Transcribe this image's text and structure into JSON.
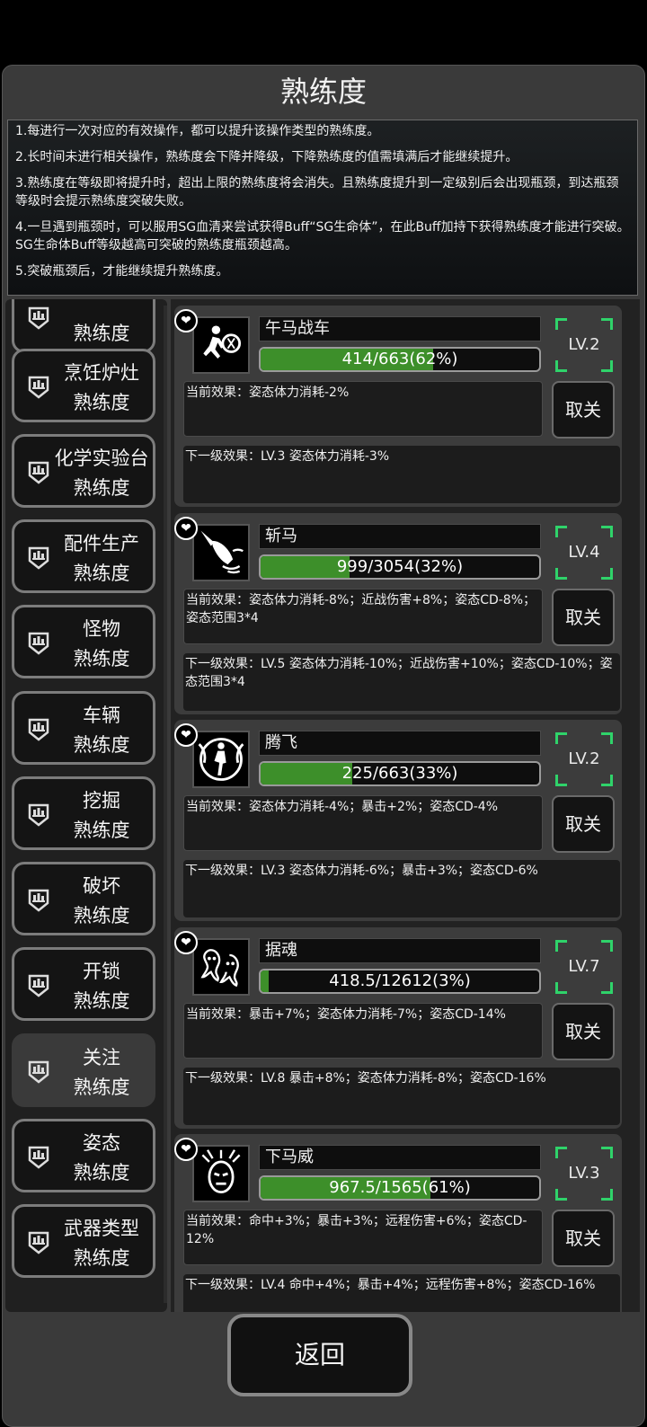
{
  "title": "熟练度",
  "info": [
    "1.每进行一次对应的有效操作，都可以提升该操作类型的熟练度。",
    "2.长时间未进行相关操作，熟练度会下降并降级，下降熟练度的值需填满后才能继续提升。",
    "3.熟练度在等级即将提升时，超出上限的熟练度将会消失。且熟练度提升到一定级别后会出现瓶颈，到达瓶颈等级时会提示熟练度突破失败。",
    "4.一旦遇到瓶颈时，可以服用SG血清来尝试获得Buff“SG生命体”，在此Buff加持下获得熟练度才能进行突破。SG生命体Buff等级越高可突破的熟练度瓶颈越高。",
    "5.突破瓶颈后，才能继续提升熟练度。"
  ],
  "categories": [
    {
      "line1": "",
      "line2": "熟练度"
    },
    {
      "line1": "烹饪炉灶",
      "line2": "熟练度"
    },
    {
      "line1": "化学实验台",
      "line2": "熟练度"
    },
    {
      "line1": "配件生产",
      "line2": "熟练度"
    },
    {
      "line1": "怪物",
      "line2": "熟练度"
    },
    {
      "line1": "车辆",
      "line2": "熟练度"
    },
    {
      "line1": "挖掘",
      "line2": "熟练度"
    },
    {
      "line1": "破坏",
      "line2": "熟练度"
    },
    {
      "line1": "开锁",
      "line2": "熟练度"
    },
    {
      "line1": "关注",
      "line2": "熟练度"
    },
    {
      "line1": "姿态",
      "line2": "熟练度"
    },
    {
      "line1": "武器类型",
      "line2": "熟练度"
    }
  ],
  "active_category_index": 9,
  "cancel_label": "取关",
  "skills": [
    {
      "name": "午马战车",
      "progress_text": "414/663(62%)",
      "progress": 0.62,
      "level": "LV.2",
      "current": "当前效果：姿态体力消耗-2%",
      "next": "下一级效果：LV.3 姿态体力消耗-3%"
    },
    {
      "name": "斩马",
      "progress_text": "999/3054(32%)",
      "progress": 0.32,
      "level": "LV.4",
      "current": "当前效果：姿态体力消耗-8%；近战伤害+8%；姿态CD-8%；姿态范围3*4",
      "next": "下一级效果：LV.5 姿态体力消耗-10%；近战伤害+10%；姿态CD-10%；姿态范围3*4"
    },
    {
      "name": "腾飞",
      "progress_text": "225/663(33%)",
      "progress": 0.33,
      "level": "LV.2",
      "current": "当前效果：姿态体力消耗-4%；暴击+2%；姿态CD-4%",
      "next": "下一级效果：LV.3 姿态体力消耗-6%；暴击+3%；姿态CD-6%"
    },
    {
      "name": "据魂",
      "progress_text": "418.5/12612(3%)",
      "progress": 0.03,
      "level": "LV.7",
      "current": "当前效果：暴击+7%；姿态体力消耗-7%；姿态CD-14%",
      "next": "下一级效果：LV.8 暴击+8%；姿态体力消耗-8%；姿态CD-16%"
    },
    {
      "name": "下马威",
      "progress_text": "967.5/1565(61%)",
      "progress": 0.61,
      "level": "LV.3",
      "current": "当前效果：命中+3%；暴击+3%；远程伤害+6%；姿态CD-12%",
      "next": "下一级效果：LV.4 命中+4%；暴击+4%；远程伤害+8%；姿态CD-16%"
    }
  ],
  "back_label": "返回"
}
